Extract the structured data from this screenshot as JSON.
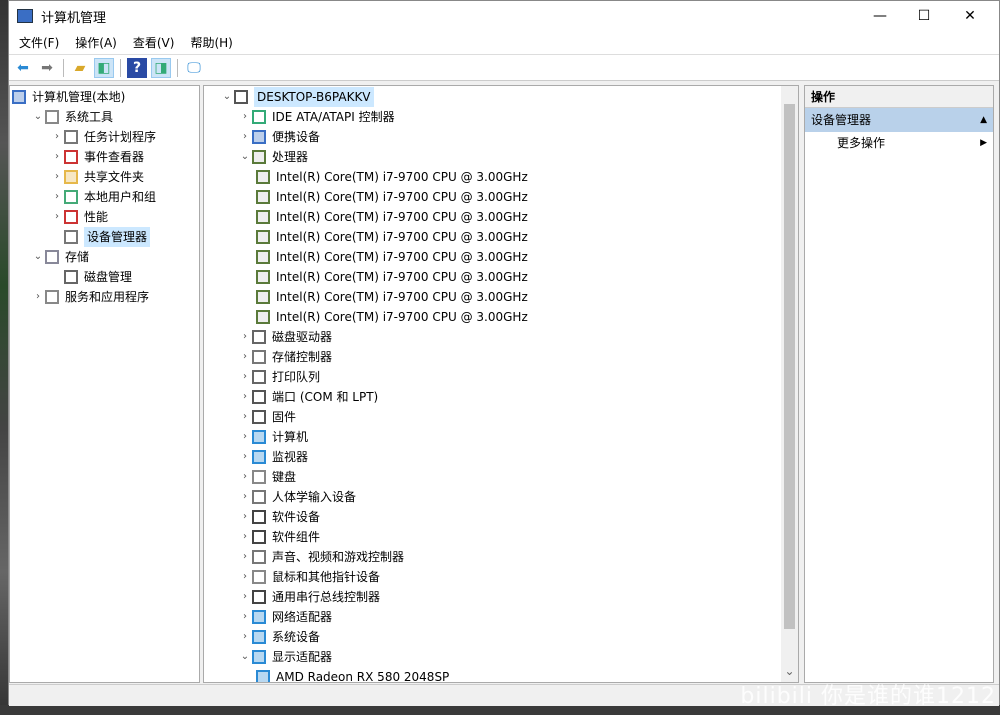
{
  "window": {
    "title": "计算机管理",
    "minimize": "—",
    "maximize": "☐",
    "close": "✕"
  },
  "menu": [
    "文件(F)",
    "操作(A)",
    "查看(V)",
    "帮助(H)"
  ],
  "left_tree": [
    {
      "label": "计算机管理(本地)",
      "level": 0,
      "arrow": "",
      "icon": "computer-management-icon",
      "color": "#3a6ec4"
    },
    {
      "label": "系统工具",
      "level": 1,
      "arrow": "⌄",
      "icon": "tools-icon",
      "color": "#888"
    },
    {
      "label": "任务计划程序",
      "level": 2,
      "arrow": "›",
      "icon": "clock-icon",
      "color": "#777"
    },
    {
      "label": "事件查看器",
      "level": 2,
      "arrow": "›",
      "icon": "event-viewer-icon",
      "color": "#c33"
    },
    {
      "label": "共享文件夹",
      "level": 2,
      "arrow": "›",
      "icon": "shared-folder-icon",
      "color": "#e6b84a"
    },
    {
      "label": "本地用户和组",
      "level": 2,
      "arrow": "›",
      "icon": "users-icon",
      "color": "#4a7"
    },
    {
      "label": "性能",
      "level": 2,
      "arrow": "›",
      "icon": "performance-icon",
      "color": "#c33"
    },
    {
      "label": "设备管理器",
      "level": 2,
      "arrow": "",
      "icon": "device-manager-icon",
      "color": "#777",
      "selected": true
    },
    {
      "label": "存储",
      "level": 1,
      "arrow": "⌄",
      "icon": "storage-icon",
      "color": "#889"
    },
    {
      "label": "磁盘管理",
      "level": 2,
      "arrow": "",
      "icon": "disk-icon",
      "color": "#666"
    },
    {
      "label": "服务和应用程序",
      "level": 1,
      "arrow": "›",
      "icon": "services-icon",
      "color": "#888"
    }
  ],
  "device_tree": [
    {
      "label": "DESKTOP-B6PAKKV",
      "level": 0,
      "arrow": "⌄",
      "icon": "computer-icon",
      "color": "#555",
      "selected": true
    },
    {
      "label": "IDE ATA/ATAPI 控制器",
      "level": 1,
      "arrow": "›",
      "icon": "ide-controller-icon",
      "color": "#3a7"
    },
    {
      "label": "便携设备",
      "level": 1,
      "arrow": "›",
      "icon": "portable-device-icon",
      "color": "#3a6ec4"
    },
    {
      "label": "处理器",
      "level": 1,
      "arrow": "⌄",
      "icon": "processor-icon",
      "color": "#5a7a3a"
    },
    {
      "label": "Intel(R) Core(TM) i7-9700 CPU @ 3.00GHz",
      "level": 2,
      "icon": "processor-icon",
      "color": "#5a7a3a"
    },
    {
      "label": "Intel(R) Core(TM) i7-9700 CPU @ 3.00GHz",
      "level": 2,
      "icon": "processor-icon",
      "color": "#5a7a3a"
    },
    {
      "label": "Intel(R) Core(TM) i7-9700 CPU @ 3.00GHz",
      "level": 2,
      "icon": "processor-icon",
      "color": "#5a7a3a"
    },
    {
      "label": "Intel(R) Core(TM) i7-9700 CPU @ 3.00GHz",
      "level": 2,
      "icon": "processor-icon",
      "color": "#5a7a3a"
    },
    {
      "label": "Intel(R) Core(TM) i7-9700 CPU @ 3.00GHz",
      "level": 2,
      "icon": "processor-icon",
      "color": "#5a7a3a"
    },
    {
      "label": "Intel(R) Core(TM) i7-9700 CPU @ 3.00GHz",
      "level": 2,
      "icon": "processor-icon",
      "color": "#5a7a3a"
    },
    {
      "label": "Intel(R) Core(TM) i7-9700 CPU @ 3.00GHz",
      "level": 2,
      "icon": "processor-icon",
      "color": "#5a7a3a"
    },
    {
      "label": "Intel(R) Core(TM) i7-9700 CPU @ 3.00GHz",
      "level": 2,
      "icon": "processor-icon",
      "color": "#5a7a3a"
    },
    {
      "label": "磁盘驱动器",
      "level": 1,
      "arrow": "›",
      "icon": "disk-drive-icon",
      "color": "#666"
    },
    {
      "label": "存储控制器",
      "level": 1,
      "arrow": "›",
      "icon": "storage-controller-icon",
      "color": "#777"
    },
    {
      "label": "打印队列",
      "level": 1,
      "arrow": "›",
      "icon": "printer-icon",
      "color": "#666"
    },
    {
      "label": "端口 (COM 和 LPT)",
      "level": 1,
      "arrow": "›",
      "icon": "port-icon",
      "color": "#555"
    },
    {
      "label": "固件",
      "level": 1,
      "arrow": "›",
      "icon": "firmware-icon",
      "color": "#555"
    },
    {
      "label": "计算机",
      "level": 1,
      "arrow": "›",
      "icon": "monitor-icon",
      "color": "#2a8ad4"
    },
    {
      "label": "监视器",
      "level": 1,
      "arrow": "›",
      "icon": "monitor-icon",
      "color": "#2a8ad4"
    },
    {
      "label": "键盘",
      "level": 1,
      "arrow": "›",
      "icon": "keyboard-icon",
      "color": "#888"
    },
    {
      "label": "人体学输入设备",
      "level": 1,
      "arrow": "›",
      "icon": "hid-icon",
      "color": "#777"
    },
    {
      "label": "软件设备",
      "level": 1,
      "arrow": "›",
      "icon": "software-device-icon",
      "color": "#444"
    },
    {
      "label": "软件组件",
      "level": 1,
      "arrow": "›",
      "icon": "software-component-icon",
      "color": "#444"
    },
    {
      "label": "声音、视频和游戏控制器",
      "level": 1,
      "arrow": "›",
      "icon": "speaker-icon",
      "color": "#777"
    },
    {
      "label": "鼠标和其他指针设备",
      "level": 1,
      "arrow": "›",
      "icon": "mouse-icon",
      "color": "#888"
    },
    {
      "label": "通用串行总线控制器",
      "level": 1,
      "arrow": "›",
      "icon": "usb-icon",
      "color": "#444"
    },
    {
      "label": "网络适配器",
      "level": 1,
      "arrow": "›",
      "icon": "network-adapter-icon",
      "color": "#2a8ad4"
    },
    {
      "label": "系统设备",
      "level": 1,
      "arrow": "›",
      "icon": "system-device-icon",
      "color": "#2a8ad4"
    },
    {
      "label": "显示适配器",
      "level": 1,
      "arrow": "⌄",
      "icon": "display-adapter-icon",
      "color": "#2a8ad4"
    },
    {
      "label": "AMD Radeon RX 580 2048SP",
      "level": 2,
      "icon": "display-adapter-icon",
      "color": "#2a8ad4"
    }
  ],
  "actions": {
    "header": "操作",
    "section": "设备管理器",
    "more": "更多操作"
  },
  "watermark": "bilibili 你是谁的谁1212",
  "scroll_down": "⌄"
}
